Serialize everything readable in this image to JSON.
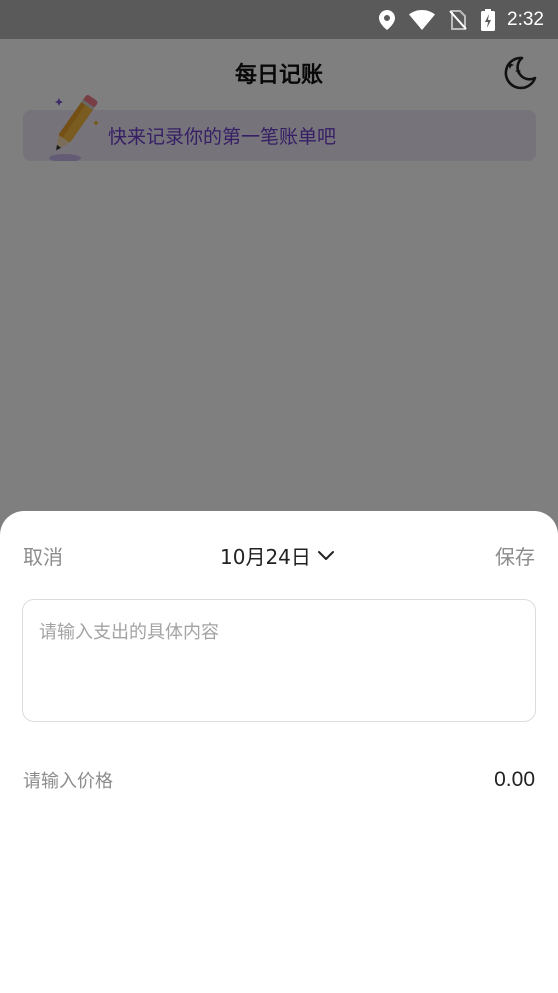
{
  "status_bar": {
    "time": "2:32",
    "icons": [
      "location-icon",
      "wifi-icon",
      "no-sim-icon",
      "battery-charging-icon"
    ]
  },
  "header": {
    "title": "每日记账",
    "theme_toggle_icon": "moon-stars-icon"
  },
  "banner": {
    "text": "快来记录你的第一笔账单吧",
    "icon": "pencil-icon"
  },
  "sheet": {
    "cancel_label": "取消",
    "date_label": "10月24日",
    "save_label": "保存",
    "content_placeholder": "请输入支出的具体内容",
    "price_label": "请输入价格",
    "price_value": "0.00"
  },
  "colors": {
    "banner_bg": "#ece7f7",
    "banner_text": "#6d3fc8",
    "muted_text": "#8c8c8c",
    "overlay": "rgba(0,0,0,0.5)"
  }
}
